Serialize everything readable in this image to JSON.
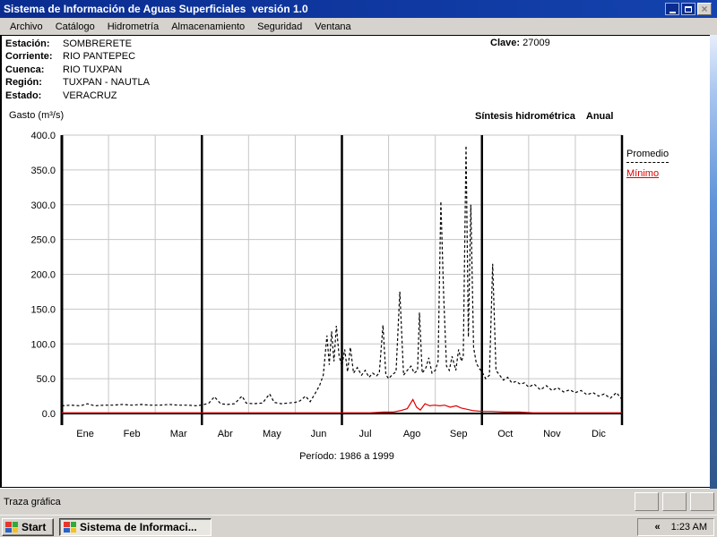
{
  "window": {
    "title": "Sistema de Información de Aguas Superficiales  versión 1.0"
  },
  "menu": {
    "items": [
      "Archivo",
      "Catálogo",
      "Hidrometría",
      "Almacenamiento",
      "Seguridad",
      "Ventana"
    ]
  },
  "station": {
    "rows": [
      {
        "label": "Estación:",
        "value": "SOMBRERETE"
      },
      {
        "label": "Corriente:",
        "value": "RIO PANTEPEC"
      },
      {
        "label": "Cuenca:",
        "value": "RIO TUXPAN"
      },
      {
        "label": "Región:",
        "value": "TUXPAN - NAUTLA"
      },
      {
        "label": "Estado:",
        "value": "VERACRUZ"
      }
    ],
    "clave_label": "Clave:",
    "clave_value": "27009"
  },
  "chart_header": {
    "y_axis_title": "Gasto (m³/s)",
    "right_title": "Síntesis hidrométrica",
    "right_mode": "Anual"
  },
  "chart_data": {
    "type": "line",
    "title": "Síntesis hidrométrica Anual",
    "ylabel": "Gasto (m³/s)",
    "ylim": [
      0,
      400
    ],
    "ytick_step": 50,
    "grid": true,
    "months": [
      "Ene",
      "Feb",
      "Mar",
      "Abr",
      "May",
      "Jun",
      "Jul",
      "Ago",
      "Sep",
      "Oct",
      "Nov",
      "Dic"
    ],
    "quarter_lines_after_months": [
      3,
      6,
      9
    ],
    "footer": "Período: 1986 a 1999",
    "legend_position": "right-outside",
    "series": [
      {
        "name": "Promedio",
        "color": "#000000",
        "style": "dashed",
        "points": [
          [
            0,
            11
          ],
          [
            0.2,
            12
          ],
          [
            0.4,
            11
          ],
          [
            0.55,
            14
          ],
          [
            0.7,
            11
          ],
          [
            0.9,
            12
          ],
          [
            1.1,
            12
          ],
          [
            1.3,
            13
          ],
          [
            1.5,
            12
          ],
          [
            1.7,
            13
          ],
          [
            1.9,
            12
          ],
          [
            2.1,
            12
          ],
          [
            2.3,
            13
          ],
          [
            2.5,
            12
          ],
          [
            2.7,
            12
          ],
          [
            2.9,
            11
          ],
          [
            3.05,
            13
          ],
          [
            3.15,
            15
          ],
          [
            3.27,
            24
          ],
          [
            3.4,
            14
          ],
          [
            3.55,
            13
          ],
          [
            3.7,
            14
          ],
          [
            3.86,
            25
          ],
          [
            3.95,
            15
          ],
          [
            4.1,
            14
          ],
          [
            4.3,
            15
          ],
          [
            4.45,
            28
          ],
          [
            4.55,
            16
          ],
          [
            4.7,
            14
          ],
          [
            4.85,
            15
          ],
          [
            5.0,
            16
          ],
          [
            5.1,
            18
          ],
          [
            5.22,
            25
          ],
          [
            5.32,
            17
          ],
          [
            5.42,
            28
          ],
          [
            5.52,
            40
          ],
          [
            5.6,
            55
          ],
          [
            5.68,
            112
          ],
          [
            5.73,
            70
          ],
          [
            5.78,
            118
          ],
          [
            5.83,
            75
          ],
          [
            5.88,
            126
          ],
          [
            5.94,
            82
          ],
          [
            6.0,
            68
          ],
          [
            6.06,
            92
          ],
          [
            6.12,
            60
          ],
          [
            6.18,
            95
          ],
          [
            6.25,
            58
          ],
          [
            6.33,
            66
          ],
          [
            6.42,
            55
          ],
          [
            6.5,
            62
          ],
          [
            6.58,
            52
          ],
          [
            6.66,
            58
          ],
          [
            6.74,
            54
          ],
          [
            6.8,
            58
          ],
          [
            6.88,
            127
          ],
          [
            6.94,
            56
          ],
          [
            7.0,
            50
          ],
          [
            7.08,
            56
          ],
          [
            7.16,
            60
          ],
          [
            7.24,
            175
          ],
          [
            7.32,
            55
          ],
          [
            7.4,
            62
          ],
          [
            7.48,
            68
          ],
          [
            7.55,
            58
          ],
          [
            7.62,
            62
          ],
          [
            7.66,
            145
          ],
          [
            7.72,
            58
          ],
          [
            7.8,
            66
          ],
          [
            7.86,
            80
          ],
          [
            7.93,
            58
          ],
          [
            8.0,
            62
          ],
          [
            8.06,
            75
          ],
          [
            8.12,
            305
          ],
          [
            8.18,
            170
          ],
          [
            8.24,
            68
          ],
          [
            8.3,
            62
          ],
          [
            8.36,
            82
          ],
          [
            8.44,
            62
          ],
          [
            8.5,
            92
          ],
          [
            8.56,
            75
          ],
          [
            8.6,
            82
          ],
          [
            8.66,
            385
          ],
          [
            8.71,
            110
          ],
          [
            8.76,
            300
          ],
          [
            8.82,
            95
          ],
          [
            8.88,
            72
          ],
          [
            8.94,
            65
          ],
          [
            9.0,
            60
          ],
          [
            9.08,
            50
          ],
          [
            9.16,
            55
          ],
          [
            9.23,
            215
          ],
          [
            9.3,
            62
          ],
          [
            9.38,
            55
          ],
          [
            9.46,
            48
          ],
          [
            9.55,
            52
          ],
          [
            9.64,
            44
          ],
          [
            9.73,
            46
          ],
          [
            9.82,
            42
          ],
          [
            9.91,
            44
          ],
          [
            10.0,
            38
          ],
          [
            10.12,
            42
          ],
          [
            10.25,
            34
          ],
          [
            10.38,
            40
          ],
          [
            10.5,
            33
          ],
          [
            10.62,
            37
          ],
          [
            10.75,
            31
          ],
          [
            10.88,
            34
          ],
          [
            11.0,
            30
          ],
          [
            11.12,
            33
          ],
          [
            11.25,
            27
          ],
          [
            11.38,
            30
          ],
          [
            11.5,
            25
          ],
          [
            11.62,
            28
          ],
          [
            11.75,
            22
          ],
          [
            11.88,
            30
          ],
          [
            12.0,
            20
          ]
        ]
      },
      {
        "name": "Mínimo",
        "color": "#e00000",
        "style": "solid",
        "points": [
          [
            0,
            1
          ],
          [
            3,
            1
          ],
          [
            5,
            1
          ],
          [
            6.6,
            1
          ],
          [
            6.9,
            2
          ],
          [
            7.1,
            2
          ],
          [
            7.25,
            4
          ],
          [
            7.4,
            7
          ],
          [
            7.52,
            20
          ],
          [
            7.6,
            9
          ],
          [
            7.68,
            5
          ],
          [
            7.78,
            14
          ],
          [
            7.88,
            11
          ],
          [
            7.98,
            12
          ],
          [
            8.1,
            11
          ],
          [
            8.2,
            12
          ],
          [
            8.32,
            9
          ],
          [
            8.45,
            11
          ],
          [
            8.55,
            8
          ],
          [
            8.68,
            6
          ],
          [
            8.82,
            4
          ],
          [
            9.0,
            3
          ],
          [
            9.2,
            3
          ],
          [
            9.5,
            2
          ],
          [
            9.8,
            2
          ],
          [
            10.1,
            1
          ],
          [
            10.5,
            1
          ],
          [
            11.0,
            1
          ],
          [
            12.0,
            1
          ]
        ]
      }
    ]
  },
  "status_bar": {
    "text": "Traza gráfica"
  },
  "taskbar": {
    "start_label": "Start",
    "task_label": "Sistema de Informaci...",
    "tray_chevron": "«",
    "clock": "1:23 AM"
  },
  "colors": {
    "titlebar": "#0a2c90",
    "chrome_grey": "#d6d3ce",
    "gridline": "#c6c6c6",
    "promedio": "#000000",
    "minimo": "#e00000"
  }
}
